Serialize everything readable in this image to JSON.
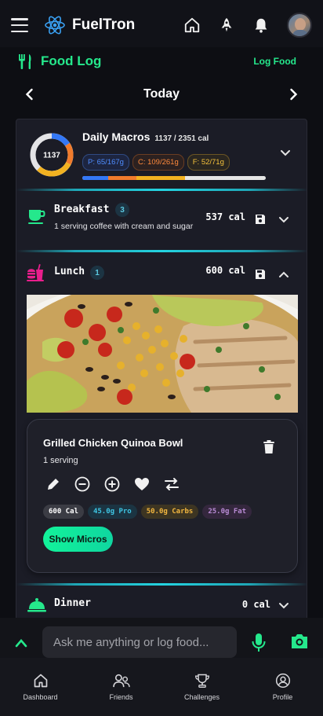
{
  "app": {
    "name": "FuelTron"
  },
  "header": {
    "icons": [
      "menu-icon",
      "atom-logo-icon",
      "home-icon",
      "rocket-icon",
      "bell-icon",
      "avatar"
    ]
  },
  "food_log": {
    "title": "Food Log",
    "log_food_label": "Log Food"
  },
  "date_nav": {
    "label": "Today"
  },
  "macros": {
    "title": "Daily Macros",
    "summary": "1137 / 2351 cal",
    "calories": "1137",
    "protein": "P: 65/167g",
    "carbs": "C: 109/261g",
    "fat": "F: 52/71g",
    "protein_frac": 0.389,
    "carbs_frac": 0.418,
    "fat_frac": 0.732,
    "cal_frac": 0.484,
    "colors": {
      "protein": "#3478f6",
      "carbs": "#f07b2c",
      "fat": "#f2b221"
    }
  },
  "meals": {
    "breakfast": {
      "name": "Breakfast",
      "count": "3",
      "calories": "537 cal",
      "description": "1 serving coffee with cream and sugar"
    },
    "lunch": {
      "name": "Lunch",
      "count": "1",
      "calories": "600 cal"
    },
    "dinner": {
      "name": "Dinner",
      "calories": "0 cal"
    }
  },
  "food_item": {
    "name": "Grilled Chicken Quinoa Bowl",
    "serving": "1 serving",
    "cal_chip": "600 Cal",
    "pro_chip": "45.0g Pro",
    "carbs_chip": "50.0g Carbs",
    "fat_chip": "25.0g Fat",
    "show_micros_label": "Show Micros"
  },
  "chat": {
    "placeholder": "Ask me anything or log food..."
  },
  "bottom_nav": [
    {
      "label": "Dashboard"
    },
    {
      "label": "Friends"
    },
    {
      "label": "Challenges"
    },
    {
      "label": "Profile"
    }
  ],
  "accent": "#25e88c"
}
